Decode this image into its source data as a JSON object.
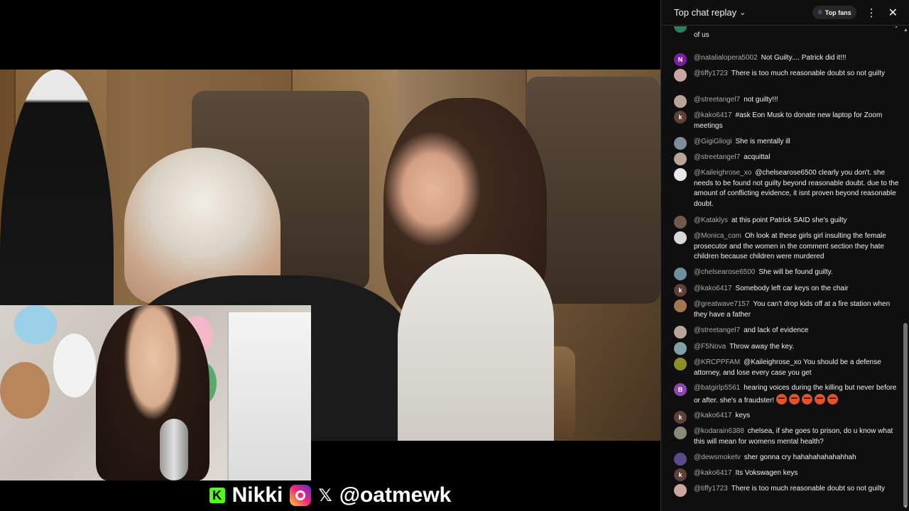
{
  "brand": {
    "kick_logo": "K",
    "name": "Nikki",
    "x_icon": "𝕏",
    "handle": "@oatmewk"
  },
  "chat": {
    "title": "Top chat replay",
    "top_fans_label": "Top fans",
    "messages": [
      {
        "author": "",
        "text": "life and so on is not normal haha Chelsea is not smarter than any of us",
        "avatar": {
          "type": "color",
          "color": "#2e7d5b",
          "letter": ""
        }
      },
      {
        "author": "@natalialopera5002",
        "text": "Not Guilty.... Patrick did it!!!",
        "avatar": {
          "type": "letter",
          "color": "#7b1fa2",
          "letter": "N"
        }
      },
      {
        "author": "@tiffy1723",
        "text": "There is too much reasonable doubt so not guilty",
        "avatar": {
          "type": "image",
          "color": "#c9a7a0",
          "letter": ""
        }
      },
      {
        "author": "@streetangel7",
        "text": "not guilty!!!",
        "avatar": {
          "type": "image",
          "color": "#b8a498",
          "letter": ""
        }
      },
      {
        "author": "@kako6417",
        "text": "#ask Eon Musk to donate new laptop for Zoom meetings",
        "avatar": {
          "type": "letter",
          "color": "#5d4037",
          "letter": "k"
        }
      },
      {
        "author": "@GigiGliogi",
        "text": "She is mentally ill",
        "avatar": {
          "type": "image",
          "color": "#7e8e9c",
          "letter": ""
        }
      },
      {
        "author": "@streetangel7",
        "text": "acquittal",
        "avatar": {
          "type": "image",
          "color": "#b8a498",
          "letter": ""
        }
      },
      {
        "author": "@Kaileighrose_xo",
        "text": "@chelsearose6500 clearly you don't. she needs to be found not guilty beyond reasonable doubt. due to the amount of conflicting evidence, it isnt proven beyond reasonable doubt.",
        "avatar": {
          "type": "image",
          "color": "#e8e8e8",
          "letter": ""
        }
      },
      {
        "author": "@Kataklys",
        "text": "at this point Patrick SAID she's guilty",
        "avatar": {
          "type": "image",
          "color": "#6d5a4a",
          "letter": ""
        }
      },
      {
        "author": "@Monica_com",
        "text": "Oh look at these girls girl insulting the female prosecutor and the women in the comment section they hate children because children were murdered",
        "avatar": {
          "type": "image",
          "color": "#d8d8d8",
          "letter": ""
        }
      },
      {
        "author": "@chelsearose6500",
        "text": "She will be found guilty.",
        "avatar": {
          "type": "image",
          "color": "#6f8f9a",
          "letter": ""
        }
      },
      {
        "author": "@kako6417",
        "text": "Somebody left car keys on the chair",
        "avatar": {
          "type": "letter",
          "color": "#5d4037",
          "letter": "k"
        }
      },
      {
        "author": "@greatwave7157",
        "text": "You can't drop kids off at a fire station when they have a father",
        "avatar": {
          "type": "image",
          "color": "#a07850",
          "letter": ""
        }
      },
      {
        "author": "@streetangel7",
        "text": "and lack of evidence",
        "avatar": {
          "type": "image",
          "color": "#b8a498",
          "letter": ""
        }
      },
      {
        "author": "@F5Nova",
        "text": "Throw away the key.",
        "avatar": {
          "type": "image",
          "color": "#7fa0a8",
          "letter": ""
        }
      },
      {
        "author": "@KRCPPFAM",
        "text": "@Kaileighrose_xo You should be a defense attorney, and lose every case you get",
        "avatar": {
          "type": "image",
          "color": "#8a8f2a",
          "letter": ""
        }
      },
      {
        "author": "@batgirlp5561",
        "text": "hearing voices during the killing but never before or after. she's a fraudster!",
        "emoji_count": 5,
        "avatar": {
          "type": "letter",
          "color": "#8e44ad",
          "letter": "B"
        }
      },
      {
        "author": "@kako6417",
        "text": "keys",
        "avatar": {
          "type": "letter",
          "color": "#5d4037",
          "letter": "k"
        }
      },
      {
        "author": "@kodarain6388",
        "text": "chelsea, if she goes to prison, do u know what this will mean for womens mental health?",
        "avatar": {
          "type": "image",
          "color": "#8a8a7a",
          "letter": ""
        }
      },
      {
        "author": "@dewsmoketv",
        "text": "sher gonna cry hahahahahahahhah",
        "avatar": {
          "type": "image",
          "color": "#5a4a8a",
          "letter": ""
        }
      },
      {
        "author": "@kako6417",
        "text": "Its Vokswagen keys",
        "avatar": {
          "type": "letter",
          "color": "#5d4037",
          "letter": "k"
        }
      },
      {
        "author": "@tiffy1723",
        "text": "There is too much reasonable doubt so not guilty",
        "avatar": {
          "type": "image",
          "color": "#c9a7a0",
          "letter": ""
        }
      }
    ]
  }
}
